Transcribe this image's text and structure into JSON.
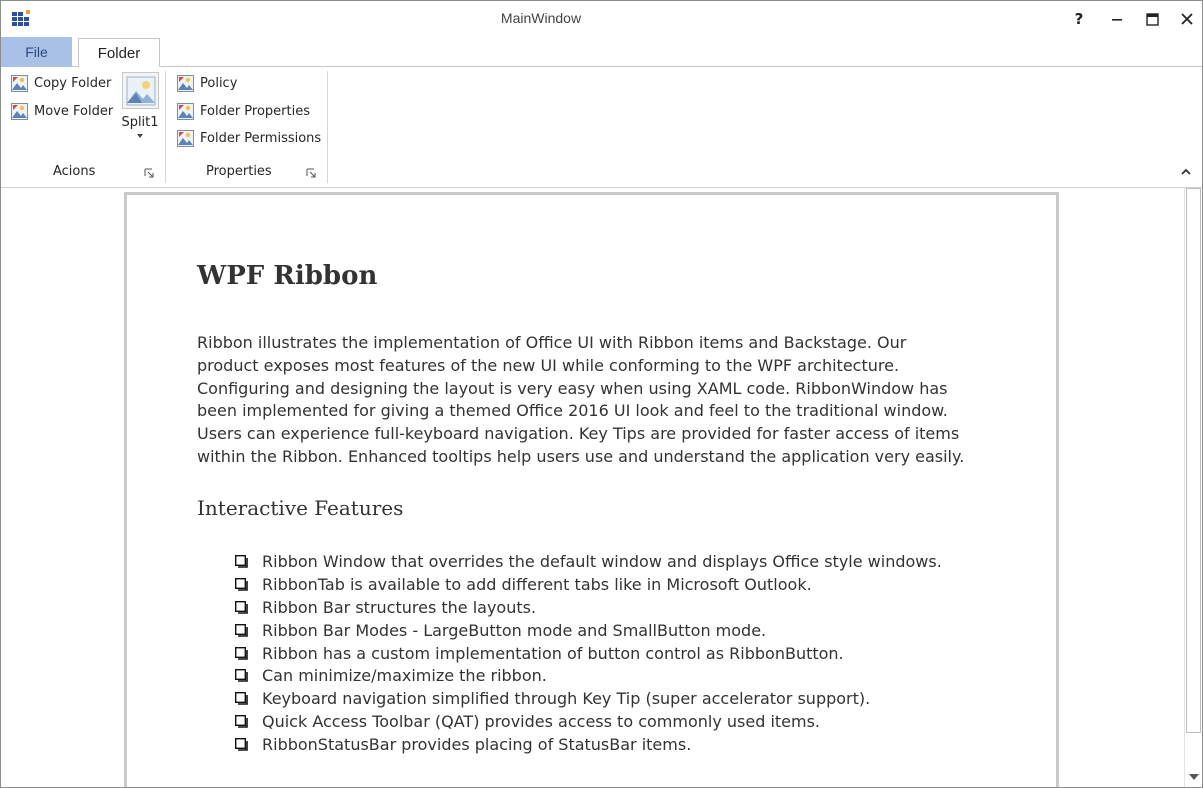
{
  "window": {
    "title": "MainWindow",
    "help_label": "?"
  },
  "tabs": [
    {
      "label": "File"
    },
    {
      "label": "Folder"
    }
  ],
  "ribbon": {
    "actions_group": {
      "label": "Acions",
      "items": [
        {
          "label": "Copy Folder"
        },
        {
          "label": "Move Folder"
        }
      ],
      "split_button": {
        "label": "Split1"
      }
    },
    "properties_group": {
      "label": "Properties",
      "items": [
        {
          "label": "Policy"
        },
        {
          "label": "Folder Properties"
        },
        {
          "label": "Folder Permissions"
        }
      ]
    }
  },
  "document": {
    "title": "WPF Ribbon",
    "paragraph": "Ribbon illustrates the implementation of Office UI with Ribbon items and Backstage. Our product exposes most features of the new UI while conforming to the WPF architecture. Configuring and designing the layout is very easy when using XAML code. RibbonWindow has been implemented for giving a themed Office 2016 UI look and feel to the traditional window. Users can experience full-keyboard navigation. Key Tips are provided for faster access of items within the Ribbon. Enhanced tooltips help users use and understand the application very easily.",
    "subtitle": "Interactive  Features",
    "features": [
      "Ribbon Window that overrides the default window and displays Office style windows.",
      "RibbonTab is available to add different tabs like in Microsoft Outlook.",
      "Ribbon Bar structures the layouts.",
      "Ribbon Bar Modes - LargeButton mode and SmallButton mode.",
      "Ribbon has a custom implementation of button control as RibbonButton.",
      "Can minimize/maximize the ribbon.",
      "Keyboard navigation simplified through Key Tip (super accelerator support).",
      "Quick Access Toolbar (QAT) provides access to commonly used items.",
      "RibbonStatusBar provides placing of StatusBar items."
    ]
  },
  "colors": {
    "file_tab_bg": "#a9c1e7",
    "file_tab_text": "#2d4a80",
    "app_icon_blue": "#2b4f9e",
    "app_icon_orange": "#f0a030"
  }
}
